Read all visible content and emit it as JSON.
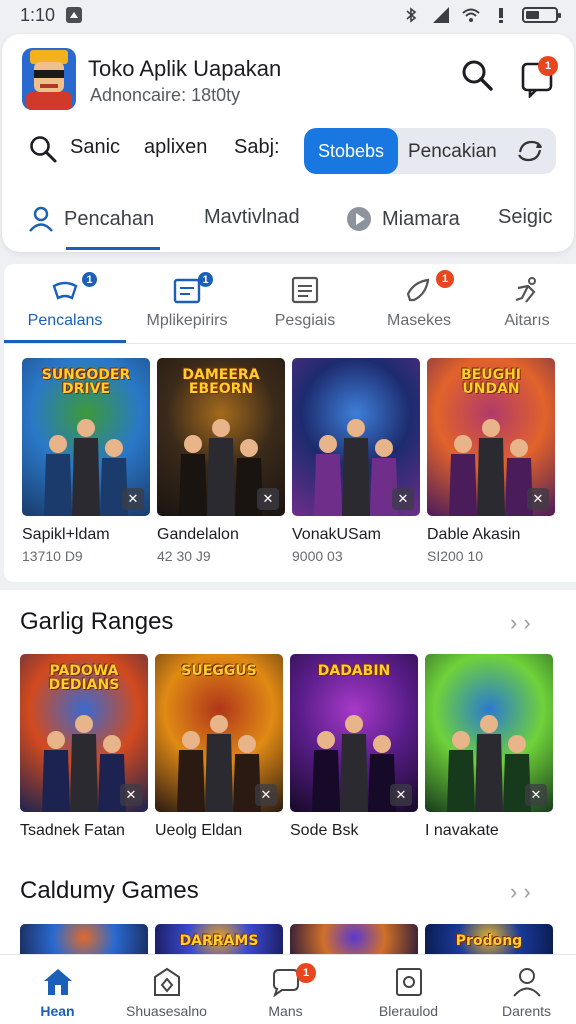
{
  "status_bar": {
    "time": "1:10"
  },
  "header": {
    "title": "Toko Aplik Uapakan",
    "subtitle": "Adnoncaire: 18t0ty",
    "notification_count": "1"
  },
  "search_row": {
    "items": [
      "Sanic",
      "aplixen",
      "Sabj:"
    ],
    "segment_active": "Stobebs",
    "segment_other": "Pencakian"
  },
  "top_tabs": [
    "Pencahan",
    "Mavtivlnad",
    "Miamara",
    "Seigic"
  ],
  "category_tabs": [
    {
      "label": "Pencalans",
      "icon": "controller-icon",
      "badge": "1"
    },
    {
      "label": "Mplikepirirs",
      "icon": "calendar-icon",
      "badge": "1"
    },
    {
      "label": "Pesgiais",
      "icon": "list-icon",
      "badge": ""
    },
    {
      "label": "Masekes",
      "icon": "rocket-icon",
      "badge": "1"
    },
    {
      "label": "Aitarıs",
      "icon": "running-icon",
      "badge": ""
    }
  ],
  "featured_games": [
    {
      "name": "Sapikl+ldam",
      "meta": "13710 D9",
      "art_title": "SUNGODER DRIVE",
      "colors": [
        "#2a78c8",
        "#3c9a3a",
        "#1a3b6b"
      ]
    },
    {
      "name": "Gandelalon",
      "meta": "42 30 J9",
      "art_title": "DAMEERA EBEORN",
      "colors": [
        "#3a2a1a",
        "#a46a1c",
        "#1a1410"
      ]
    },
    {
      "name": "VonakUSam",
      "meta": "9000 03",
      "art_title": "",
      "colors": [
        "#1d2b6e",
        "#3e7fd8",
        "#6e2e8a"
      ]
    },
    {
      "name": "Dable Akasin",
      "meta": "SI200 10",
      "art_title": "BEUGHI UNDAN",
      "colors": [
        "#e2632a",
        "#b03a6a",
        "#4a1c5a"
      ]
    }
  ],
  "sections": [
    {
      "title": "Garlig Ranges",
      "games": [
        {
          "name": "Tsadnek Fatan",
          "art_title": "PADOWA DEDIANS",
          "colors": [
            "#d24a1e",
            "#3a6ad0",
            "#1c2350"
          ]
        },
        {
          "name": "Ueolg Eldan",
          "art_title": "SUEGGUS",
          "colors": [
            "#e08a14",
            "#b0361a",
            "#2a1a12"
          ]
        },
        {
          "name": "Sode Bsk",
          "art_title": "DADABIN",
          "colors": [
            "#5a1d8a",
            "#a63ac8",
            "#160a28"
          ]
        },
        {
          "name": "I navakate",
          "art_title": "",
          "colors": [
            "#6fd23a",
            "#2c7ad0",
            "#183a1c"
          ]
        }
      ]
    },
    {
      "title": "Caldumy Games",
      "games": [
        {
          "name": "",
          "art_title": "",
          "colors": [
            "#2a6ad0",
            "#e06a2a",
            "#1a2a5a"
          ]
        },
        {
          "name": "",
          "art_title": "DARRAMS",
          "colors": [
            "#3a4ad0",
            "#e0a02a",
            "#1a1a5a"
          ]
        },
        {
          "name": "",
          "art_title": "",
          "colors": [
            "#d0702a",
            "#5a3ad0",
            "#2a1a3a"
          ]
        },
        {
          "name": "",
          "art_title": "Prodong",
          "colors": [
            "#1a3a9a",
            "#e0b02a",
            "#0a1a4a"
          ]
        }
      ]
    }
  ],
  "bottom_nav": [
    {
      "label": "Hean",
      "icon": "home-icon",
      "active": true,
      "badge": ""
    },
    {
      "label": "Shuasesalno",
      "icon": "store-icon",
      "active": false,
      "badge": ""
    },
    {
      "label": "Mans",
      "icon": "chat-icon",
      "active": false,
      "badge": "1"
    },
    {
      "label": "Bleraulod",
      "icon": "download-icon",
      "active": false,
      "badge": ""
    },
    {
      "label": "Darents",
      "icon": "profile-icon",
      "active": false,
      "badge": ""
    }
  ],
  "colors": {
    "accent": "#1877e0",
    "badge": "#e8461f",
    "underline": "#1b5fb8"
  }
}
